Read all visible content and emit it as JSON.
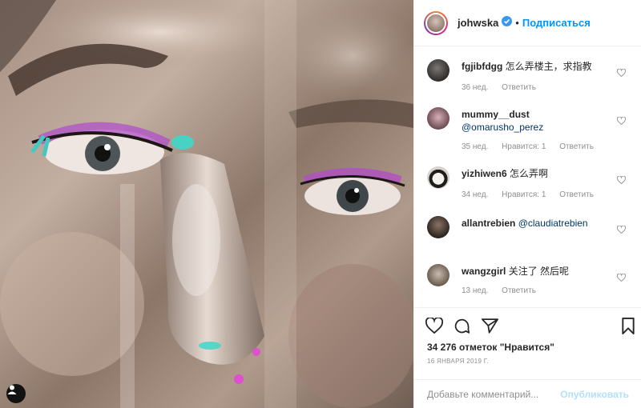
{
  "post": {
    "author": "johwska",
    "verified": true,
    "follow_label": "Подписаться",
    "separator": "•"
  },
  "comments": [
    {
      "user": "fgjibfdgg",
      "text": "怎么弄楼主，求指教",
      "mention": "",
      "age": "36 нед.",
      "likes": "",
      "reply": "Ответить"
    },
    {
      "user": "mummy__dust",
      "text": "",
      "mention": "@omarusho_perez",
      "age": "35 нед.",
      "likes": "Нравится: 1",
      "reply": "Ответить"
    },
    {
      "user": "yizhiwen6",
      "text": "怎么弄啊",
      "mention": "",
      "age": "34 нед.",
      "likes": "Нравится: 1",
      "reply": "Ответить"
    },
    {
      "user": "allantrebien",
      "text": "",
      "mention": "@claudiatrebien",
      "age": "",
      "likes": "",
      "reply": ""
    },
    {
      "user": "wangzgirl",
      "text": "关注了 然后呢",
      "mention": "",
      "age": "13 нед.",
      "likes": "",
      "reply": "Ответить"
    }
  ],
  "stats": {
    "likes_text": "34 276 отметок \"Нравится\"",
    "date_text": "16 ЯНВАРЯ 2019 Г."
  },
  "comment_box": {
    "placeholder": "Добавьте комментарий...",
    "publish_label": "Опубликовать"
  },
  "icons": {
    "like": "heart-icon",
    "comment": "comment-bubble-icon",
    "share": "paper-plane-icon",
    "save": "bookmark-icon",
    "verified": "verified-badge-icon",
    "user_tag": "person-icon"
  },
  "colors": {
    "accent": "#0095f6",
    "muted": "#8e8e8e",
    "publish_disabled": "#b2dffc",
    "mention": "#003569"
  }
}
